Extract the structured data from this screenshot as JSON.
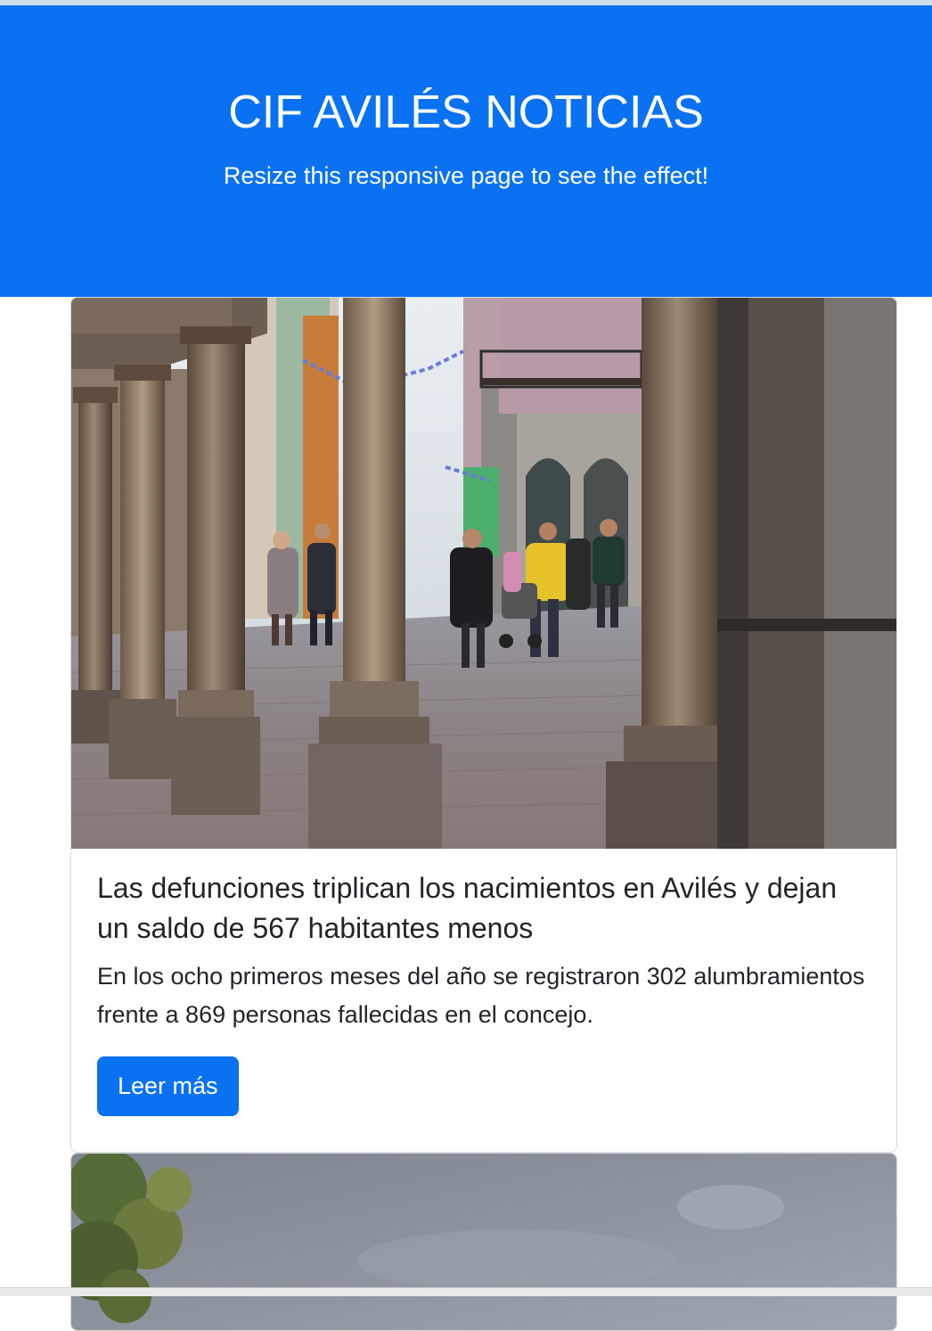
{
  "header": {
    "title": "CIF AVILÉS NOTICIAS",
    "subtitle": "Resize this responsive page to see the effect!",
    "bg_color": "#0a72f2"
  },
  "articles": [
    {
      "image": "arcade-street-photo",
      "title": "Las defunciones triplican los nacimientos en Avilés y dejan un saldo de 567 habitantes menos",
      "text": "En los ocho primeros meses del año se registraron 302 alumbramientos frente a 869 personas fallecidas en el concejo.",
      "button_label": "Leer más"
    },
    {
      "image": "cloudy-sky-photo"
    }
  ]
}
